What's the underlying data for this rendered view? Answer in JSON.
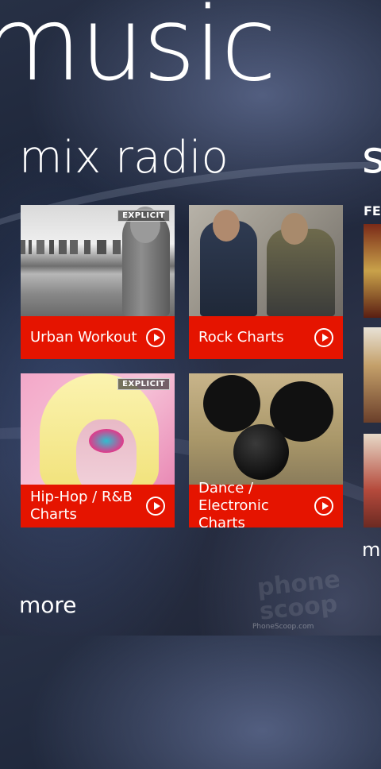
{
  "hub": {
    "title": "music"
  },
  "section": {
    "title": "mix radio",
    "next_section_peek": "s"
  },
  "tiles": [
    {
      "label": "Urban Workout",
      "explicit": "EXPLICIT"
    },
    {
      "label": "Rock Charts"
    },
    {
      "label": "Hip-Hop / R&B Charts",
      "explicit": "EXPLICIT"
    },
    {
      "label": "Dance / Electronic Charts"
    }
  ],
  "peek_column": {
    "header": "FE",
    "more": "m"
  },
  "more_link": "more",
  "watermark": {
    "text": "phone scoop",
    "url": "PhoneScoop.com"
  },
  "colors": {
    "tile_accent": "#e51400",
    "text": "#ffffff"
  },
  "icons": {
    "play": "play-circle-icon"
  }
}
